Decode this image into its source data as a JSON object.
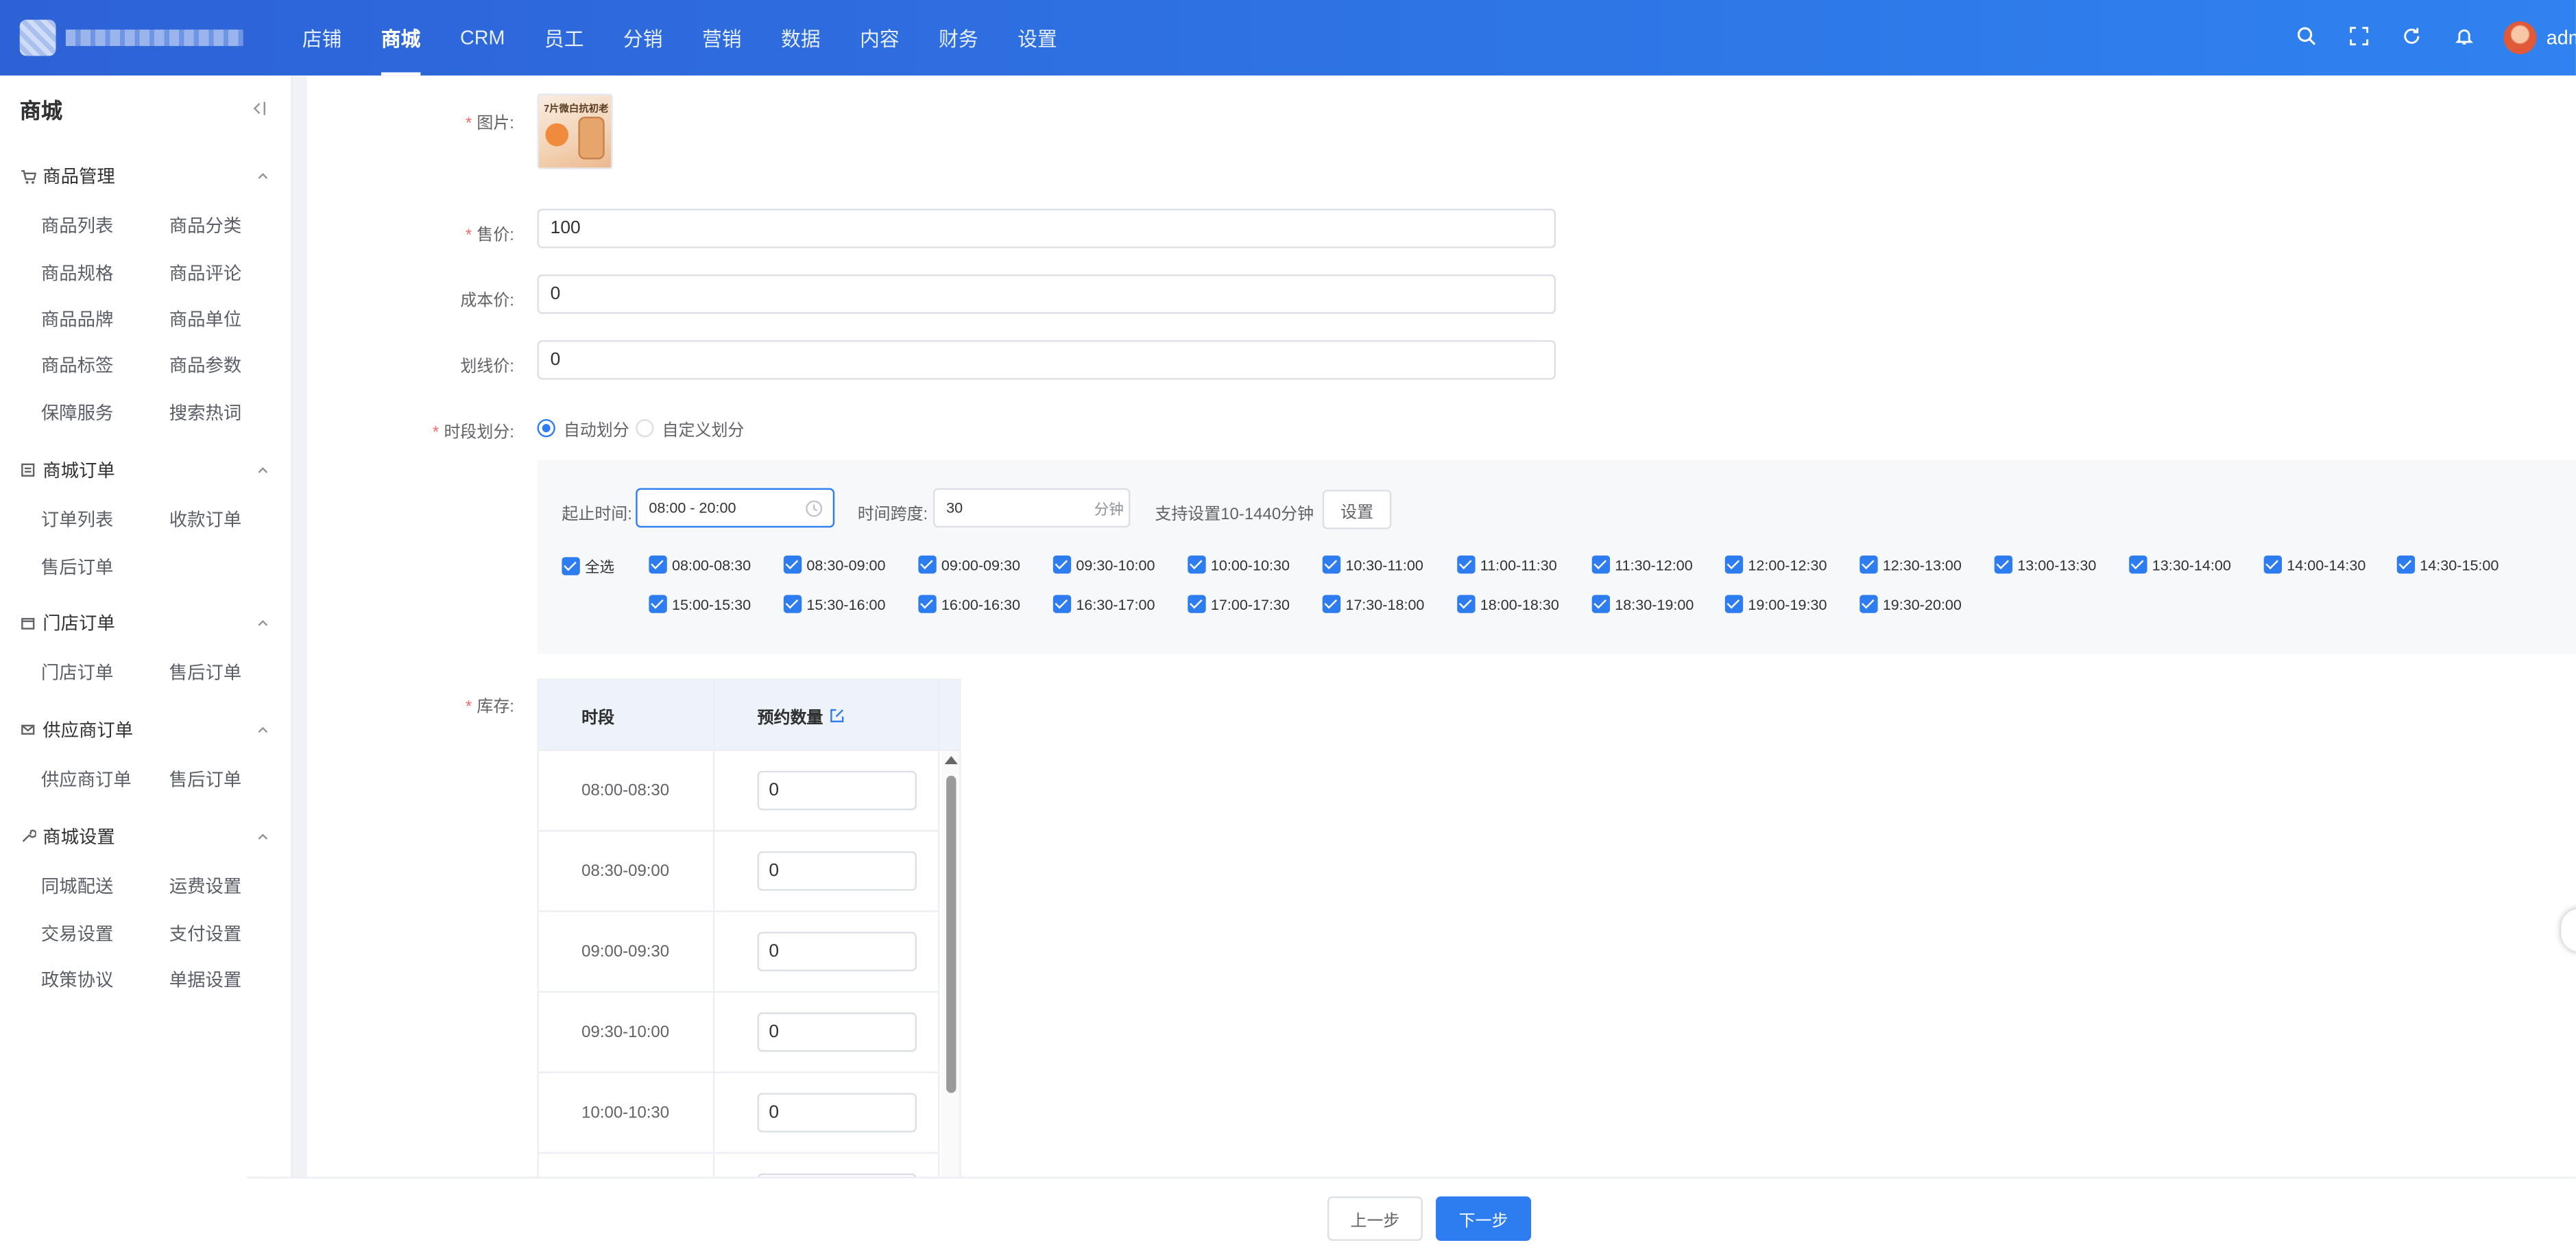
{
  "header": {
    "nav": [
      "店铺",
      "商城",
      "CRM",
      "员工",
      "分销",
      "营销",
      "数据",
      "内容",
      "财务",
      "设置"
    ],
    "active_index": 1,
    "user": "adm",
    "icons": [
      "search-icon",
      "fullscreen-icon",
      "refresh-icon",
      "bell-icon"
    ]
  },
  "sidebar": {
    "title": "商城",
    "groups": [
      {
        "title": "商品管理",
        "icon": "cart-icon",
        "items": [
          "商品列表",
          "商品分类",
          "商品规格",
          "商品评论",
          "商品品牌",
          "商品单位",
          "商品标签",
          "商品参数",
          "保障服务",
          "搜索热词"
        ]
      },
      {
        "title": "商城订单",
        "icon": "list-icon",
        "items": [
          "订单列表",
          "收款订单",
          "售后订单"
        ]
      },
      {
        "title": "门店订单",
        "icon": "store-icon",
        "items": [
          "门店订单",
          "售后订单"
        ]
      },
      {
        "title": "供应商订单",
        "icon": "mail-icon",
        "items": [
          "供应商订单",
          "售后订单"
        ]
      },
      {
        "title": "商城设置",
        "icon": "wrench-icon",
        "items": [
          "同城配送",
          "运费设置",
          "交易设置",
          "支付设置",
          "政策协议",
          "单据设置"
        ]
      }
    ]
  },
  "form": {
    "image_label": "图片:",
    "image_text": "7片微白抗初老",
    "price_label": "售价:",
    "price_value": "100",
    "cost_label": "成本价:",
    "cost_value": "0",
    "strike_label": "划线价:",
    "strike_value": "0",
    "period_label": "时段划分:",
    "radio_auto": "自动划分",
    "radio_custom": "自定义划分",
    "stock_label": "库存:"
  },
  "panel": {
    "time_label": "起止时间:",
    "time_value": "08:00 - 20:00",
    "span_label": "时间跨度:",
    "span_value": "30",
    "span_unit": "分钟",
    "hint": "支持设置10-1440分钟",
    "set_button": "设置",
    "select_all": "全选",
    "slots": [
      "08:00-08:30",
      "08:30-09:00",
      "09:00-09:30",
      "09:30-10:00",
      "10:00-10:30",
      "10:30-11:00",
      "11:00-11:30",
      "11:30-12:00",
      "12:00-12:30",
      "12:30-13:00",
      "13:00-13:30",
      "13:30-14:00",
      "14:00-14:30",
      "14:30-15:00",
      "15:00-15:30",
      "15:30-16:00",
      "16:00-16:30",
      "16:30-17:00",
      "17:00-17:30",
      "17:30-18:00",
      "18:00-18:30",
      "18:30-19:00",
      "19:00-19:30",
      "19:30-20:00"
    ]
  },
  "table": {
    "col_period": "时段",
    "col_quantity": "预约数量",
    "rows": [
      {
        "period": "08:00-08:30",
        "qty": "0"
      },
      {
        "period": "08:30-09:00",
        "qty": "0"
      },
      {
        "period": "09:00-09:30",
        "qty": "0"
      },
      {
        "period": "09:30-10:00",
        "qty": "0"
      },
      {
        "period": "10:00-10:30",
        "qty": "0"
      }
    ]
  },
  "footer": {
    "prev": "上一步",
    "next": "下一步"
  }
}
